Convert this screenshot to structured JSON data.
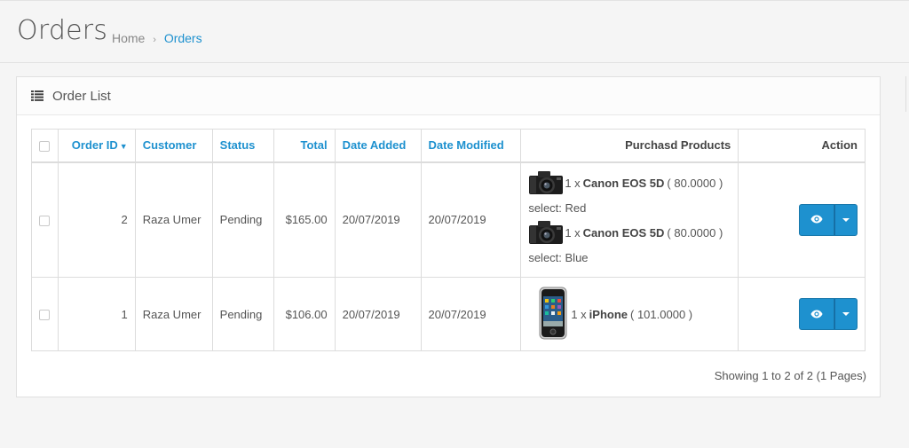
{
  "header": {
    "title": "Orders",
    "breadcrumb": {
      "home": "Home",
      "separator": "›",
      "current": "Orders"
    }
  },
  "panel": {
    "icon": "list-icon",
    "title": "Order List"
  },
  "table": {
    "columns": {
      "order_id": "Order ID",
      "customer": "Customer",
      "status": "Status",
      "total": "Total",
      "date_added": "Date Added",
      "date_modified": "Date Modified",
      "products": "Purchasd Products",
      "action": "Action"
    },
    "rows": [
      {
        "order_id": "2",
        "customer": "Raza Umer",
        "status": "Pending",
        "total": "$165.00",
        "date_added": "20/07/2019",
        "date_modified": "20/07/2019",
        "products": [
          {
            "qty": "1 x",
            "name": "Canon EOS 5D",
            "price": "( 80.0000 )",
            "option": "select: Red",
            "image": "camera"
          },
          {
            "qty": "1 x",
            "name": "Canon EOS 5D",
            "price": "( 80.0000 )",
            "option": "select: Blue",
            "image": "camera"
          }
        ]
      },
      {
        "order_id": "1",
        "customer": "Raza Umer",
        "status": "Pending",
        "total": "$106.00",
        "date_added": "20/07/2019",
        "date_modified": "20/07/2019",
        "products": [
          {
            "qty": "1 x",
            "name": "iPhone",
            "price": "( 101.0000 )",
            "image": "phone"
          }
        ]
      }
    ]
  },
  "pagination": {
    "text": "Showing 1 to 2 of 2 (1 Pages)"
  },
  "colors": {
    "accent": "#1e91cf",
    "text": "#555555"
  }
}
